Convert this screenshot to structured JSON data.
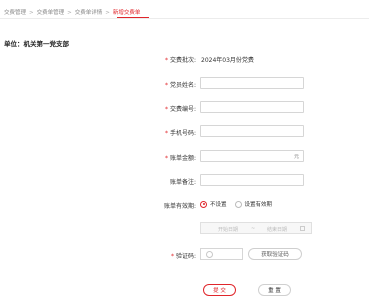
{
  "breadcrumb": {
    "items": [
      "交费管理",
      "交费单管理",
      "交费单详情",
      "新增交费单"
    ],
    "separator": ">"
  },
  "unit": "单位：机关第一党支部",
  "form": {
    "batch_label": "交费批次:",
    "batch_value": "2024年03月份党费",
    "name_label": "党员姓名:",
    "id_label": "交费编号:",
    "phone_label": "手机号码:",
    "amount_label": "账单金额:",
    "amount_unit": "元",
    "remark_label": "账单备注:",
    "validity_label": "账单有效期:",
    "validity_options": [
      "不设置",
      "设置有效期"
    ],
    "date_start_placeholder": "开始日期",
    "date_sep": "~",
    "date_end_placeholder": "结束日期",
    "captcha_label": "验证码:",
    "get_code_label": "获取验证码",
    "required_mark": "*"
  },
  "buttons": {
    "submit": "提 交",
    "reset": "重 置"
  },
  "colors": {
    "accent": "#e0262b"
  }
}
